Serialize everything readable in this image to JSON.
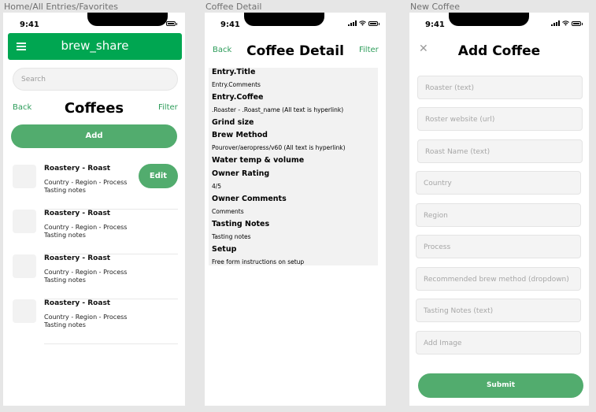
{
  "frames": {
    "home_label": "Home/All Entries/Favorites",
    "detail_label": "Coffee Detail",
    "add_label": "New Coffee"
  },
  "status_bar": {
    "time": "9:41"
  },
  "home": {
    "app_title": "brew_share",
    "search_placeholder": "Search",
    "back": "Back",
    "title": "Coffees",
    "filter": "Filter",
    "add_label": "Add",
    "edit_label": "Edit",
    "entries": [
      {
        "title": "Roastery - Roast",
        "subtitle": "Country - Region - Process",
        "notes": "Tasting notes"
      },
      {
        "title": "Roastery - Roast",
        "subtitle": "Country - Region - Process",
        "notes": "Tasting notes"
      },
      {
        "title": "Roastery - Roast",
        "subtitle": "Country - Region - Process",
        "notes": "Tasting notes"
      },
      {
        "title": "Roastery - Roast",
        "subtitle": "Country - Region - Process",
        "notes": "Tasting notes"
      }
    ]
  },
  "detail": {
    "back": "Back",
    "title": "Coffee Detail",
    "filter": "Filter",
    "rows": [
      {
        "kind": "h",
        "text": "Entry.Title"
      },
      {
        "kind": "v",
        "text": "Entry.Comments"
      },
      {
        "kind": "h",
        "text": "Entry.Coffee"
      },
      {
        "kind": "v",
        "text": ".Roaster - .Roast_name (All text is hyperlink)"
      },
      {
        "kind": "h",
        "text": "Grind size"
      },
      {
        "kind": "h",
        "text": "Brew Method"
      },
      {
        "kind": "v",
        "text": "Pourover/aeropress/v60 (All text is hyperlink)"
      },
      {
        "kind": "h",
        "text": "Water temp & volume"
      },
      {
        "kind": "h",
        "text": "Owner Rating"
      },
      {
        "kind": "v",
        "text": "4/5"
      },
      {
        "kind": "h",
        "text": "Owner Comments"
      },
      {
        "kind": "v",
        "text": "Comments"
      },
      {
        "kind": "h",
        "text": "Tasting Notes"
      },
      {
        "kind": "v",
        "text": "Tasting notes"
      },
      {
        "kind": "h",
        "text": "Setup"
      },
      {
        "kind": "v",
        "text": "Free form instructions on setup"
      }
    ]
  },
  "add": {
    "close_icon": "close-icon",
    "title": "Add Coffee",
    "fields": [
      "Roaster (text)",
      "Roster website (url)",
      "Roast Name (text)",
      "Country",
      "Region",
      "Process",
      "Recommended brew method (dropdown)",
      "Tasting Notes (text)",
      "Add Image"
    ],
    "submit": "Submit"
  }
}
